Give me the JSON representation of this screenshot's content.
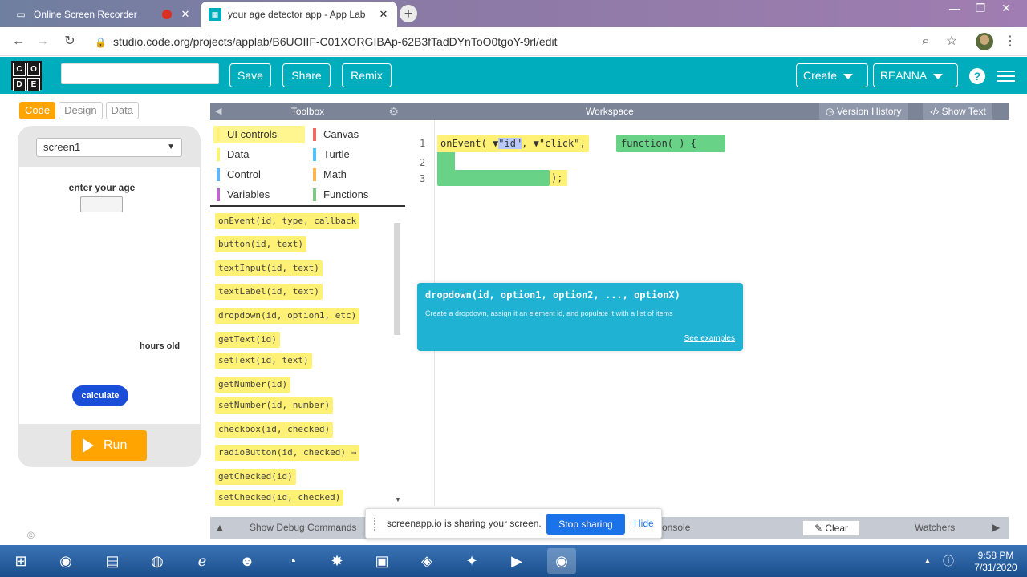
{
  "browser": {
    "tabs": [
      {
        "title": "Online Screen Recorder",
        "favicon": "screen-recorder-icon"
      },
      {
        "title": "your age detector app - App Lab",
        "favicon": "code-org-icon"
      }
    ],
    "url": "studio.code.org/projects/applab/B6UOIIF-C01XORGIBAp-62B3fTadDYnToO0tgoY-9rl/edit"
  },
  "header": {
    "logo_letters": [
      "C",
      "O",
      "D",
      "E"
    ],
    "save": "Save",
    "share": "Share",
    "remix": "Remix",
    "create": "Create",
    "user": "REANNA",
    "help": "?"
  },
  "mode": {
    "code": "Code",
    "design": "Design",
    "data": "Data"
  },
  "app": {
    "screen": "screen1",
    "age_label": "enter your age",
    "hours_label": "hours old",
    "calculate": "calculate",
    "run": "Run"
  },
  "toolbox": {
    "title": "Toolbox",
    "categories": [
      {
        "label": "UI controls",
        "color": "#fff176"
      },
      {
        "label": "Canvas",
        "color": "#f3675f"
      },
      {
        "label": "Data",
        "color": "#fff176"
      },
      {
        "label": "Turtle",
        "color": "#4fc3f7"
      },
      {
        "label": "Control",
        "color": "#64b5f6"
      },
      {
        "label": "Math",
        "color": "#ffb74d"
      },
      {
        "label": "Variables",
        "color": "#ba68c8"
      },
      {
        "label": "Functions",
        "color": "#81c784"
      }
    ],
    "blocks": [
      "onEvent(id, type, callback",
      "button(id, text)",
      "textInput(id, text)",
      "textLabel(id, text)",
      "dropdown(id, option1, etc)",
      "getText(id)",
      "setText(id, text)",
      "getNumber(id)",
      "setNumber(id, number)",
      "checkbox(id, checked)",
      "radioButton(id, checked) →",
      "getChecked(id)",
      "setChecked(id, checked)"
    ]
  },
  "workspace": {
    "title": "Workspace",
    "version_history": "Version History",
    "show_text": "Show Text",
    "line_numbers": [
      "1",
      "2",
      "3"
    ],
    "code_line_1a": "onEvent(",
    "code_id": "\"id\"",
    "code_click": "\"click\"",
    "code_fn": "function( ) {",
    "code_tail": ");",
    "tooltip_sig": "dropdown(id, option1, option2, ..., optionX)",
    "tooltip_desc": "Create a dropdown, assign it an element id, and populate it with a list of items",
    "tooltip_link": "See examples"
  },
  "debug": {
    "show_debug": "Show Debug Commands",
    "console": "onsole",
    "clear": "Clear",
    "watchers": "Watchers"
  },
  "share_banner": {
    "message": "screenapp.io is sharing your screen.",
    "stop": "Stop sharing",
    "hide": "Hide"
  },
  "clock": {
    "time": "9:58 PM",
    "date": "7/31/2020"
  }
}
